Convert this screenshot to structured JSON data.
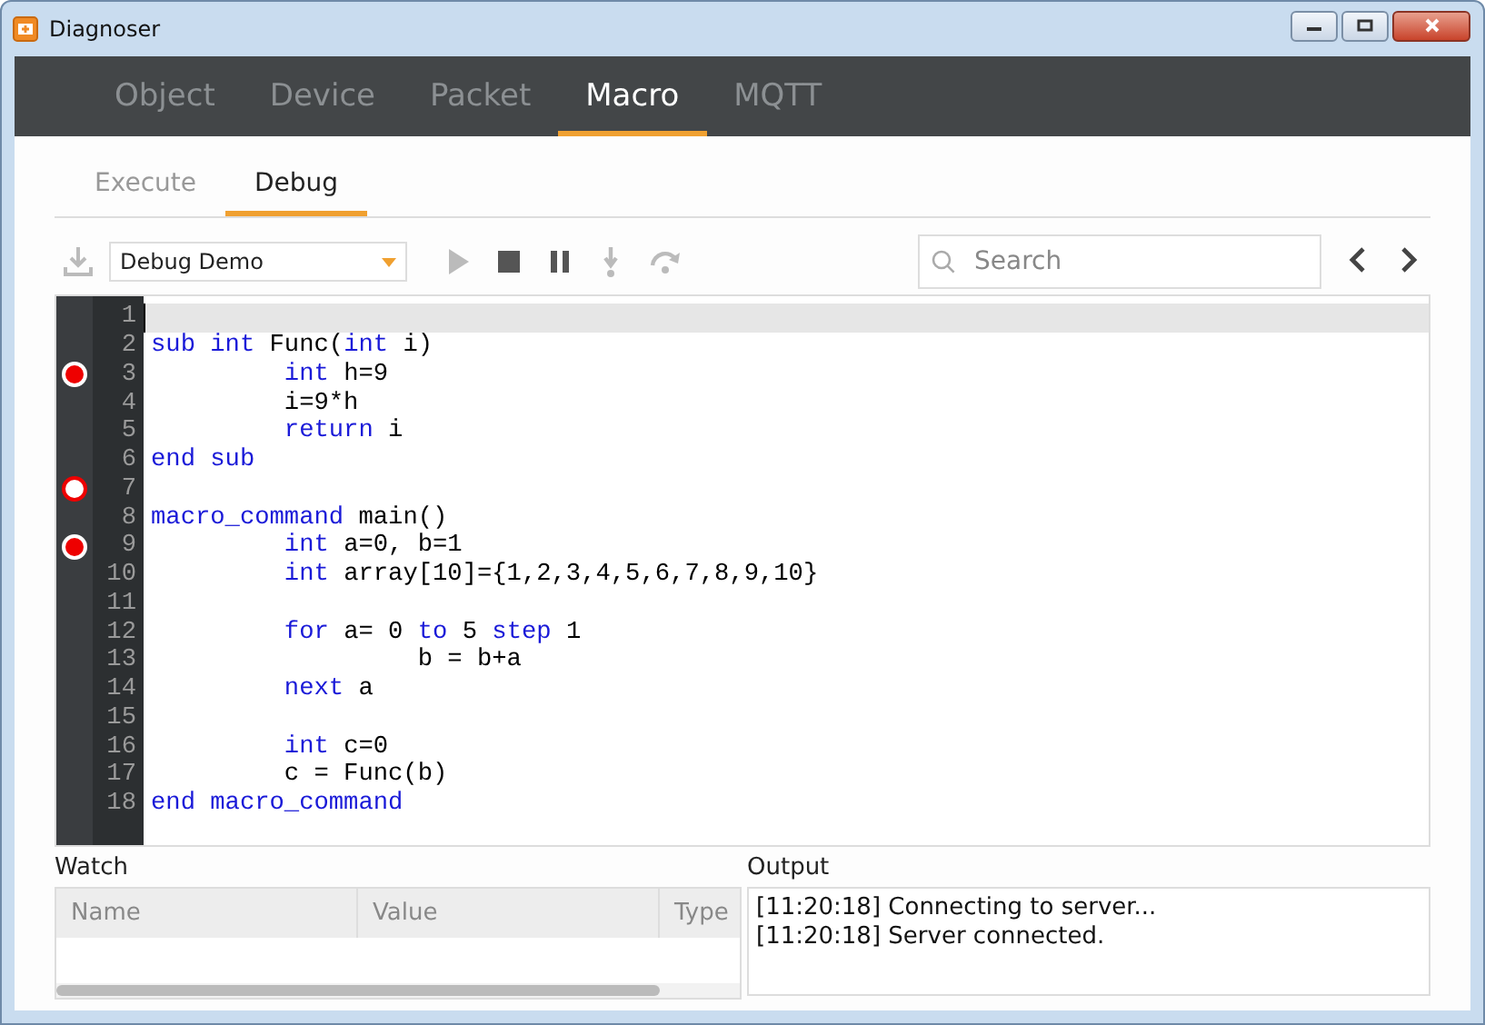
{
  "window": {
    "title": "Diagnoser"
  },
  "tabs": [
    {
      "label": "Object",
      "selected": false
    },
    {
      "label": "Device",
      "selected": false
    },
    {
      "label": "Packet",
      "selected": false
    },
    {
      "label": "Macro",
      "selected": true
    },
    {
      "label": "MQTT",
      "selected": false
    }
  ],
  "subtabs": [
    {
      "label": "Execute",
      "selected": false
    },
    {
      "label": "Debug",
      "selected": true
    }
  ],
  "toolbar": {
    "macro_select": "Debug Demo",
    "search": {
      "placeholder": "Search"
    },
    "buttons": [
      {
        "kind": "download",
        "disabled": true
      },
      {
        "kind": "play",
        "disabled": true
      },
      {
        "kind": "stop",
        "disabled": false
      },
      {
        "kind": "pause",
        "disabled": false
      },
      {
        "kind": "step-into",
        "disabled": true
      },
      {
        "kind": "step-over",
        "disabled": true
      }
    ]
  },
  "editor": {
    "lines": [
      {
        "number": "1",
        "current": true,
        "breakpoint": false
      },
      {
        "number": "2",
        "current": false,
        "breakpoint": false,
        "tokens": [
          {
            "text": "sub int",
            "kind": "keyword"
          },
          {
            "text": " Func(",
            "kind": "plain"
          },
          {
            "text": "int",
            "kind": "keyword"
          },
          {
            "text": " i)",
            "kind": "plain"
          }
        ]
      },
      {
        "number": "3",
        "current": false,
        "breakpoint": true,
        "breakpoint_disabled": false,
        "tokens": [
          {
            "text": "         int",
            "kind": "keyword"
          },
          {
            "text": " h=9",
            "kind": "plain"
          }
        ]
      },
      {
        "number": "4",
        "current": false,
        "breakpoint": false,
        "tokens": [
          {
            "text": "         i=9*h",
            "kind": "plain"
          }
        ]
      },
      {
        "number": "5",
        "current": false,
        "breakpoint": false,
        "tokens": [
          {
            "text": "         return",
            "kind": "keyword"
          },
          {
            "text": " i",
            "kind": "plain"
          }
        ]
      },
      {
        "number": "6",
        "current": false,
        "breakpoint": false,
        "tokens": [
          {
            "text": "end sub",
            "kind": "keyword"
          }
        ]
      },
      {
        "number": "7",
        "current": false,
        "breakpoint": true,
        "breakpoint_disabled": true
      },
      {
        "number": "8",
        "current": false,
        "breakpoint": false,
        "tokens": [
          {
            "text": "macro_command",
            "kind": "keyword"
          },
          {
            "text": " main()",
            "kind": "plain"
          }
        ]
      },
      {
        "number": "9",
        "current": false,
        "breakpoint": true,
        "breakpoint_disabled": false,
        "tokens": [
          {
            "text": "         int",
            "kind": "keyword"
          },
          {
            "text": " a=0, b=1",
            "kind": "plain"
          }
        ]
      },
      {
        "number": "10",
        "current": false,
        "breakpoint": false,
        "tokens": [
          {
            "text": "         int",
            "kind": "keyword"
          },
          {
            "text": " array[10]={1,2,3,4,5,6,7,8,9,10}",
            "kind": "plain"
          }
        ]
      },
      {
        "number": "11",
        "current": false,
        "breakpoint": false
      },
      {
        "number": "12",
        "current": false,
        "breakpoint": false,
        "tokens": [
          {
            "text": "         for",
            "kind": "keyword"
          },
          {
            "text": " a= 0 ",
            "kind": "plain"
          },
          {
            "text": "to",
            "kind": "keyword"
          },
          {
            "text": " 5 ",
            "kind": "plain"
          },
          {
            "text": "step",
            "kind": "keyword"
          },
          {
            "text": " 1",
            "kind": "plain"
          }
        ]
      },
      {
        "number": "13",
        "current": false,
        "breakpoint": false,
        "tokens": [
          {
            "text": "                  b = b+a",
            "kind": "plain"
          }
        ]
      },
      {
        "number": "14",
        "current": false,
        "breakpoint": false,
        "tokens": [
          {
            "text": "         next",
            "kind": "keyword"
          },
          {
            "text": " a",
            "kind": "plain"
          }
        ]
      },
      {
        "number": "15",
        "current": false,
        "breakpoint": false
      },
      {
        "number": "16",
        "current": false,
        "breakpoint": false,
        "tokens": [
          {
            "text": "         int",
            "kind": "keyword"
          },
          {
            "text": " c=0",
            "kind": "plain"
          }
        ]
      },
      {
        "number": "17",
        "current": false,
        "breakpoint": false,
        "tokens": [
          {
            "text": "         c = Func(b)",
            "kind": "plain"
          }
        ]
      },
      {
        "number": "18",
        "current": false,
        "breakpoint": false,
        "tokens": [
          {
            "text": "end macro_command",
            "kind": "keyword"
          }
        ]
      }
    ]
  },
  "watch": {
    "title": "Watch",
    "columns": [
      "Name",
      "Value",
      "Type"
    ]
  },
  "output": {
    "title": "Output",
    "lines": [
      "[11:20:18] Connecting to server...",
      "[11:20:18] Server connected."
    ]
  }
}
